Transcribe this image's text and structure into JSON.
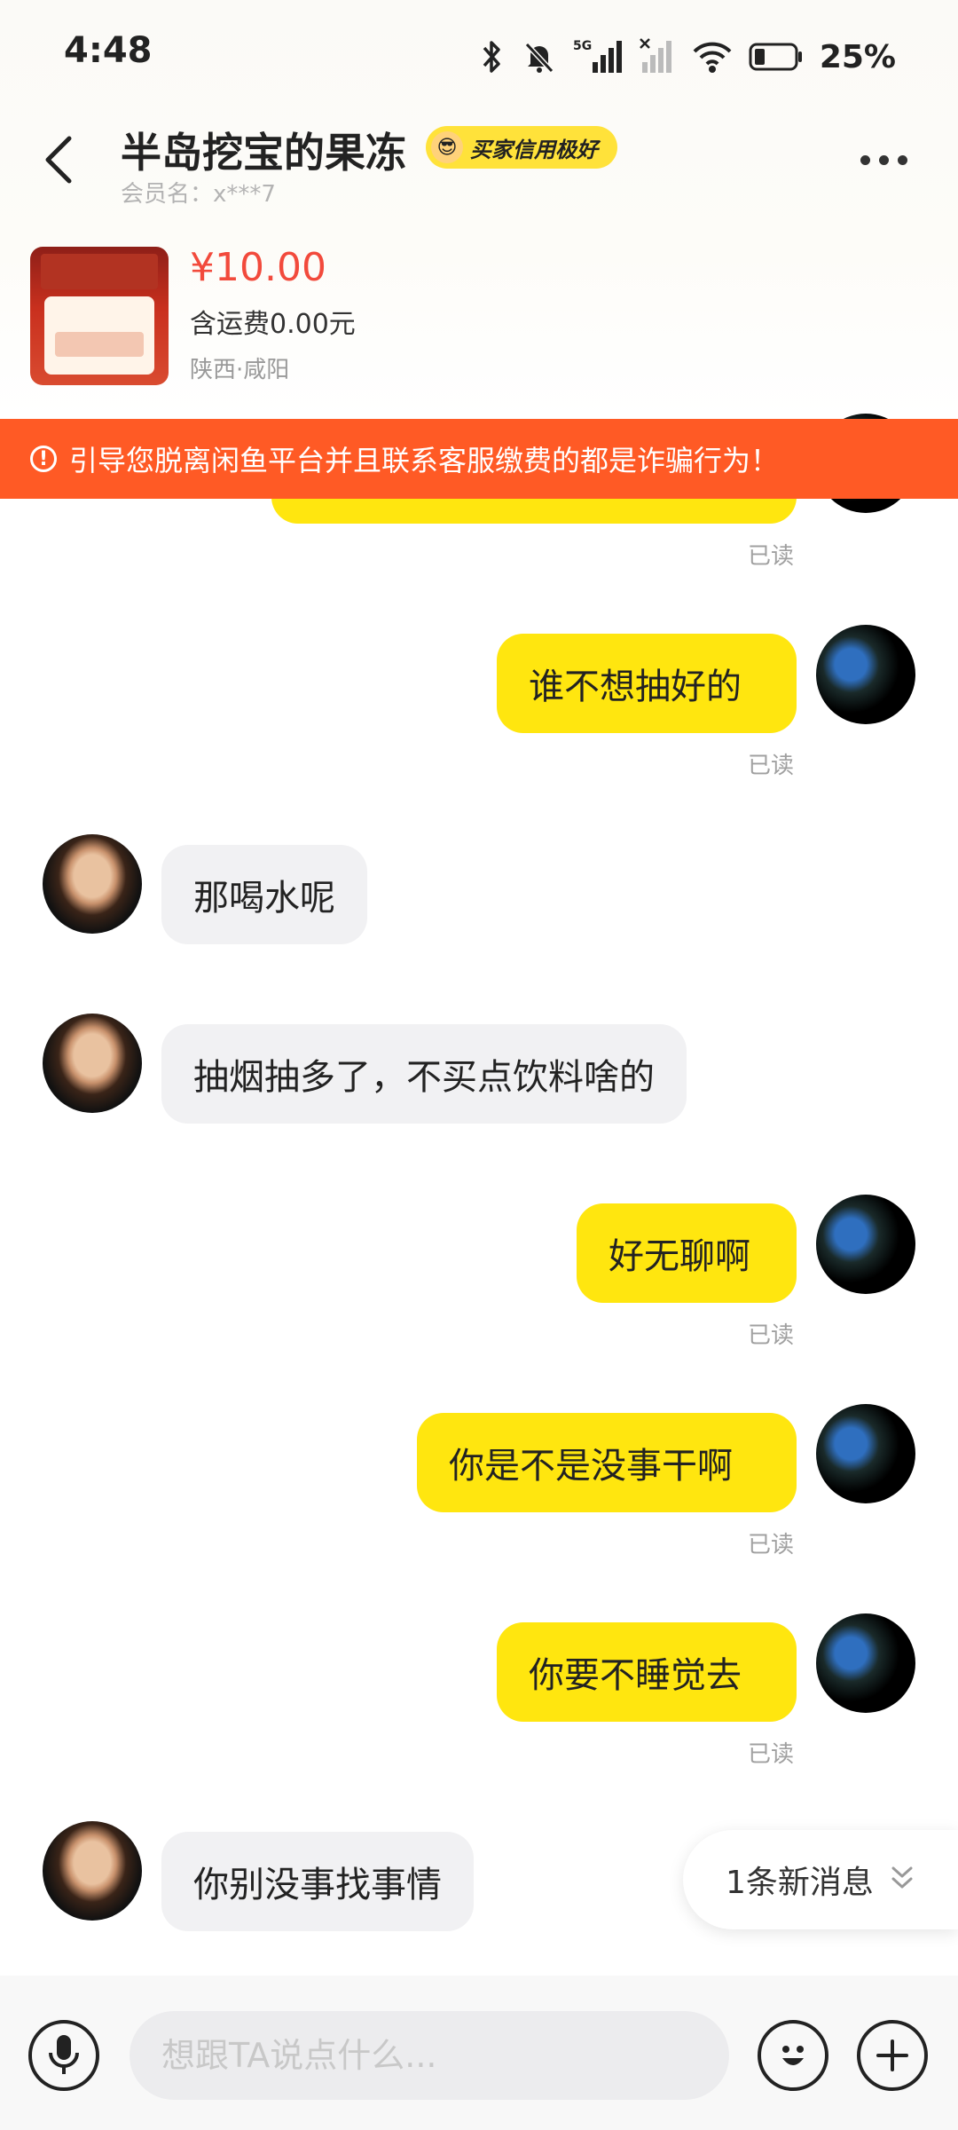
{
  "status_bar": {
    "time": "4:48",
    "network": "5G",
    "battery": "25%"
  },
  "header": {
    "title": "半岛挖宝的果冻",
    "badge": "买家信用极好",
    "member": "会员名：x***7"
  },
  "product": {
    "price": "¥10.00",
    "shipping": "含运费0.00元",
    "location": "陕西·咸阳"
  },
  "warning": {
    "icon": "alert-circle-icon",
    "text": "引导您脱离闲鱼平台并且联系客服缴费的都是诈骗行为！"
  },
  "chat": {
    "read_label": "已读",
    "messages": [
      {
        "from": "me",
        "text": "谁不想抽好的"
      },
      {
        "from": "them",
        "text": "那喝水呢"
      },
      {
        "from": "them",
        "text": "抽烟抽多了，不买点饮料啥的"
      },
      {
        "from": "me",
        "text": "好无聊啊"
      },
      {
        "from": "me",
        "text": "你是不是没事干啊"
      },
      {
        "from": "me",
        "text": "你要不睡觉去"
      },
      {
        "from": "them",
        "text": "你别没事找事情"
      }
    ],
    "new_messages": "1条新消息"
  },
  "input": {
    "placeholder": "想跟TA说点什么..."
  },
  "colors": {
    "accent": "#ffe60f",
    "warning": "#ff5a25",
    "price": "#f24a3c"
  }
}
